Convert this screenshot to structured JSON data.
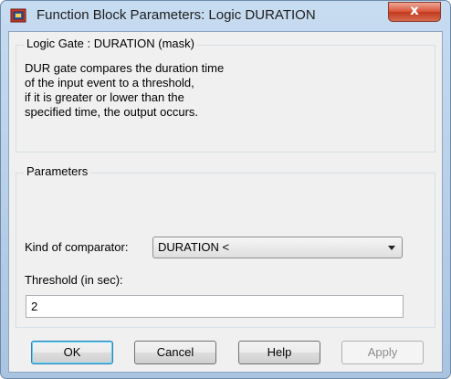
{
  "window": {
    "title": "Function Block Parameters: Logic DURATION",
    "close_glyph": "x"
  },
  "mask": {
    "heading": "Logic Gate : DURATION (mask)",
    "description_lines": [
      "DUR gate compares the duration time",
      "of the input event to a threshold,",
      "if it is greater or lower than the",
      "specified time, the output occurs."
    ]
  },
  "parameters": {
    "heading": "Parameters",
    "comparator_label": "Kind of comparator:",
    "comparator_value": "DURATION <",
    "threshold_label": "Threshold (in sec):",
    "threshold_value": "2"
  },
  "buttons": {
    "ok": "OK",
    "cancel": "Cancel",
    "help": "Help",
    "apply": "Apply"
  },
  "icons": {
    "app": "simulink-block-icon",
    "dropdown": "chevron-down-icon"
  }
}
